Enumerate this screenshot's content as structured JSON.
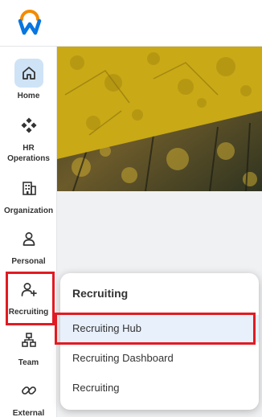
{
  "brand": {
    "logo_icon": "workday-logo-icon",
    "colors": {
      "orange": "#f38b00",
      "blue": "#0875e1"
    }
  },
  "sidebar": {
    "items": [
      {
        "label": "Home",
        "icon": "home-icon",
        "active": true
      },
      {
        "label": "HR Operations",
        "icon": "diamond-grid-icon"
      },
      {
        "label": "Organization",
        "icon": "building-icon"
      },
      {
        "label": "Personal",
        "icon": "person-icon"
      },
      {
        "label": "Recruiting",
        "icon": "add-person-icon",
        "highlighted": true
      },
      {
        "label": "Team",
        "icon": "org-chart-icon"
      },
      {
        "label": "External",
        "icon": "link-icon"
      }
    ]
  },
  "flyout": {
    "title": "Recruiting",
    "items": [
      {
        "label": "Recruiting Hub",
        "highlighted": true
      },
      {
        "label": "Recruiting Dashboard"
      },
      {
        "label": "Recruiting"
      }
    ]
  },
  "annotation_color": "#e11b22"
}
